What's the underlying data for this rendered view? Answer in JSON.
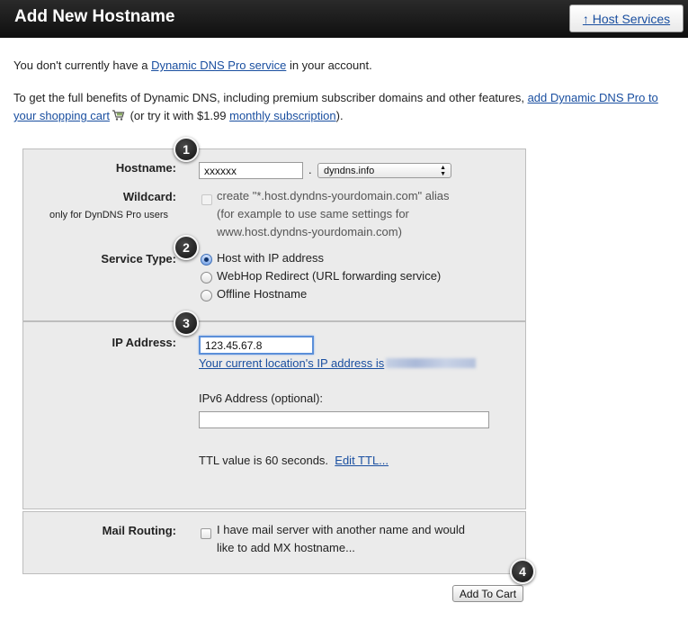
{
  "header": {
    "title": "Add New Hostname",
    "host_services_label": "↑ Host Services"
  },
  "intro": {
    "line1_pre": "You don't currently have a ",
    "line1_link": "Dynamic DNS Pro service",
    "line1_post": " in your account.",
    "line2_pre": "To get the full benefits of Dynamic DNS, including premium subscriber domains and other features, ",
    "line2_link": "add Dynamic DNS Pro to your shopping cart",
    "line2_mid": " (or try it with $1.99 ",
    "line2_link2": "monthly subscription",
    "line2_post": ")."
  },
  "form": {
    "hostname_label": "Hostname:",
    "hostname_value": "xxxxxx",
    "hostname_dot": ".",
    "domain_selected": "dyndns.info",
    "wildcard_label": "Wildcard:",
    "wildcard_sublabel": "only for DynDNS Pro users",
    "wildcard_text_1": "create \"*.host.dyndns-yourdomain.com\" alias",
    "wildcard_text_2": "(for example to use same settings for",
    "wildcard_text_3": "www.host.dyndns-yourdomain.com)",
    "service_type_label": "Service Type:",
    "service_options": [
      "Host with IP address",
      "WebHop Redirect (URL forwarding service)",
      "Offline Hostname"
    ],
    "ip_label": "IP Address:",
    "ip_value": "123.45.67.8",
    "current_ip_link": "Your current location's IP address is",
    "ipv6_label": "IPv6 Address (optional):",
    "ipv6_value": "",
    "ttl_text": "TTL value is 60 seconds.",
    "ttl_link": "Edit TTL...",
    "mail_label": "Mail Routing:",
    "mail_text_1": "I have mail server with another name and would",
    "mail_text_2": "like to add MX hostname...",
    "add_to_cart_label": "Add To Cart"
  },
  "badges": [
    "1",
    "2",
    "3",
    "4"
  ]
}
